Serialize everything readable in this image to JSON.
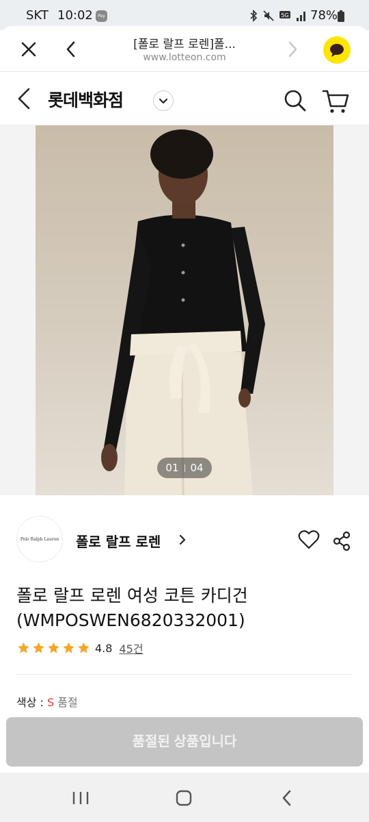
{
  "status_bar": {
    "carrier": "SKT",
    "time": "10:02",
    "pay_badge": "Pay",
    "battery": "78%",
    "icons": [
      "bluetooth-icon",
      "mute-icon",
      "5g-icon",
      "signal-icon",
      "battery-icon"
    ]
  },
  "browser": {
    "page_title": "[폴로 랄프 로렌]폴...",
    "url": "www.lotteon.com"
  },
  "header": {
    "brand": "롯데백화점"
  },
  "gallery": {
    "current": "01",
    "total": "04"
  },
  "brand": {
    "logo_text": "Polo Ralph Lauren",
    "name": "폴로 랄프 로렌"
  },
  "product": {
    "title_line1": "폴로 랄프 로렌 여성 코튼 카디건",
    "title_line2": "(WMPOSWEN6820332001)",
    "rating": "4.8",
    "stars": 5,
    "reviews": "45건"
  },
  "option": {
    "label": "색상 : ",
    "value": "S",
    "status": " 품절"
  },
  "buy_button": {
    "label": "품절된 상품입니다"
  },
  "colors": {
    "kakao": "#fee500",
    "star": "#f5a623",
    "soldout_value": "#e53935",
    "disabled_button": "#c4c4c4"
  }
}
